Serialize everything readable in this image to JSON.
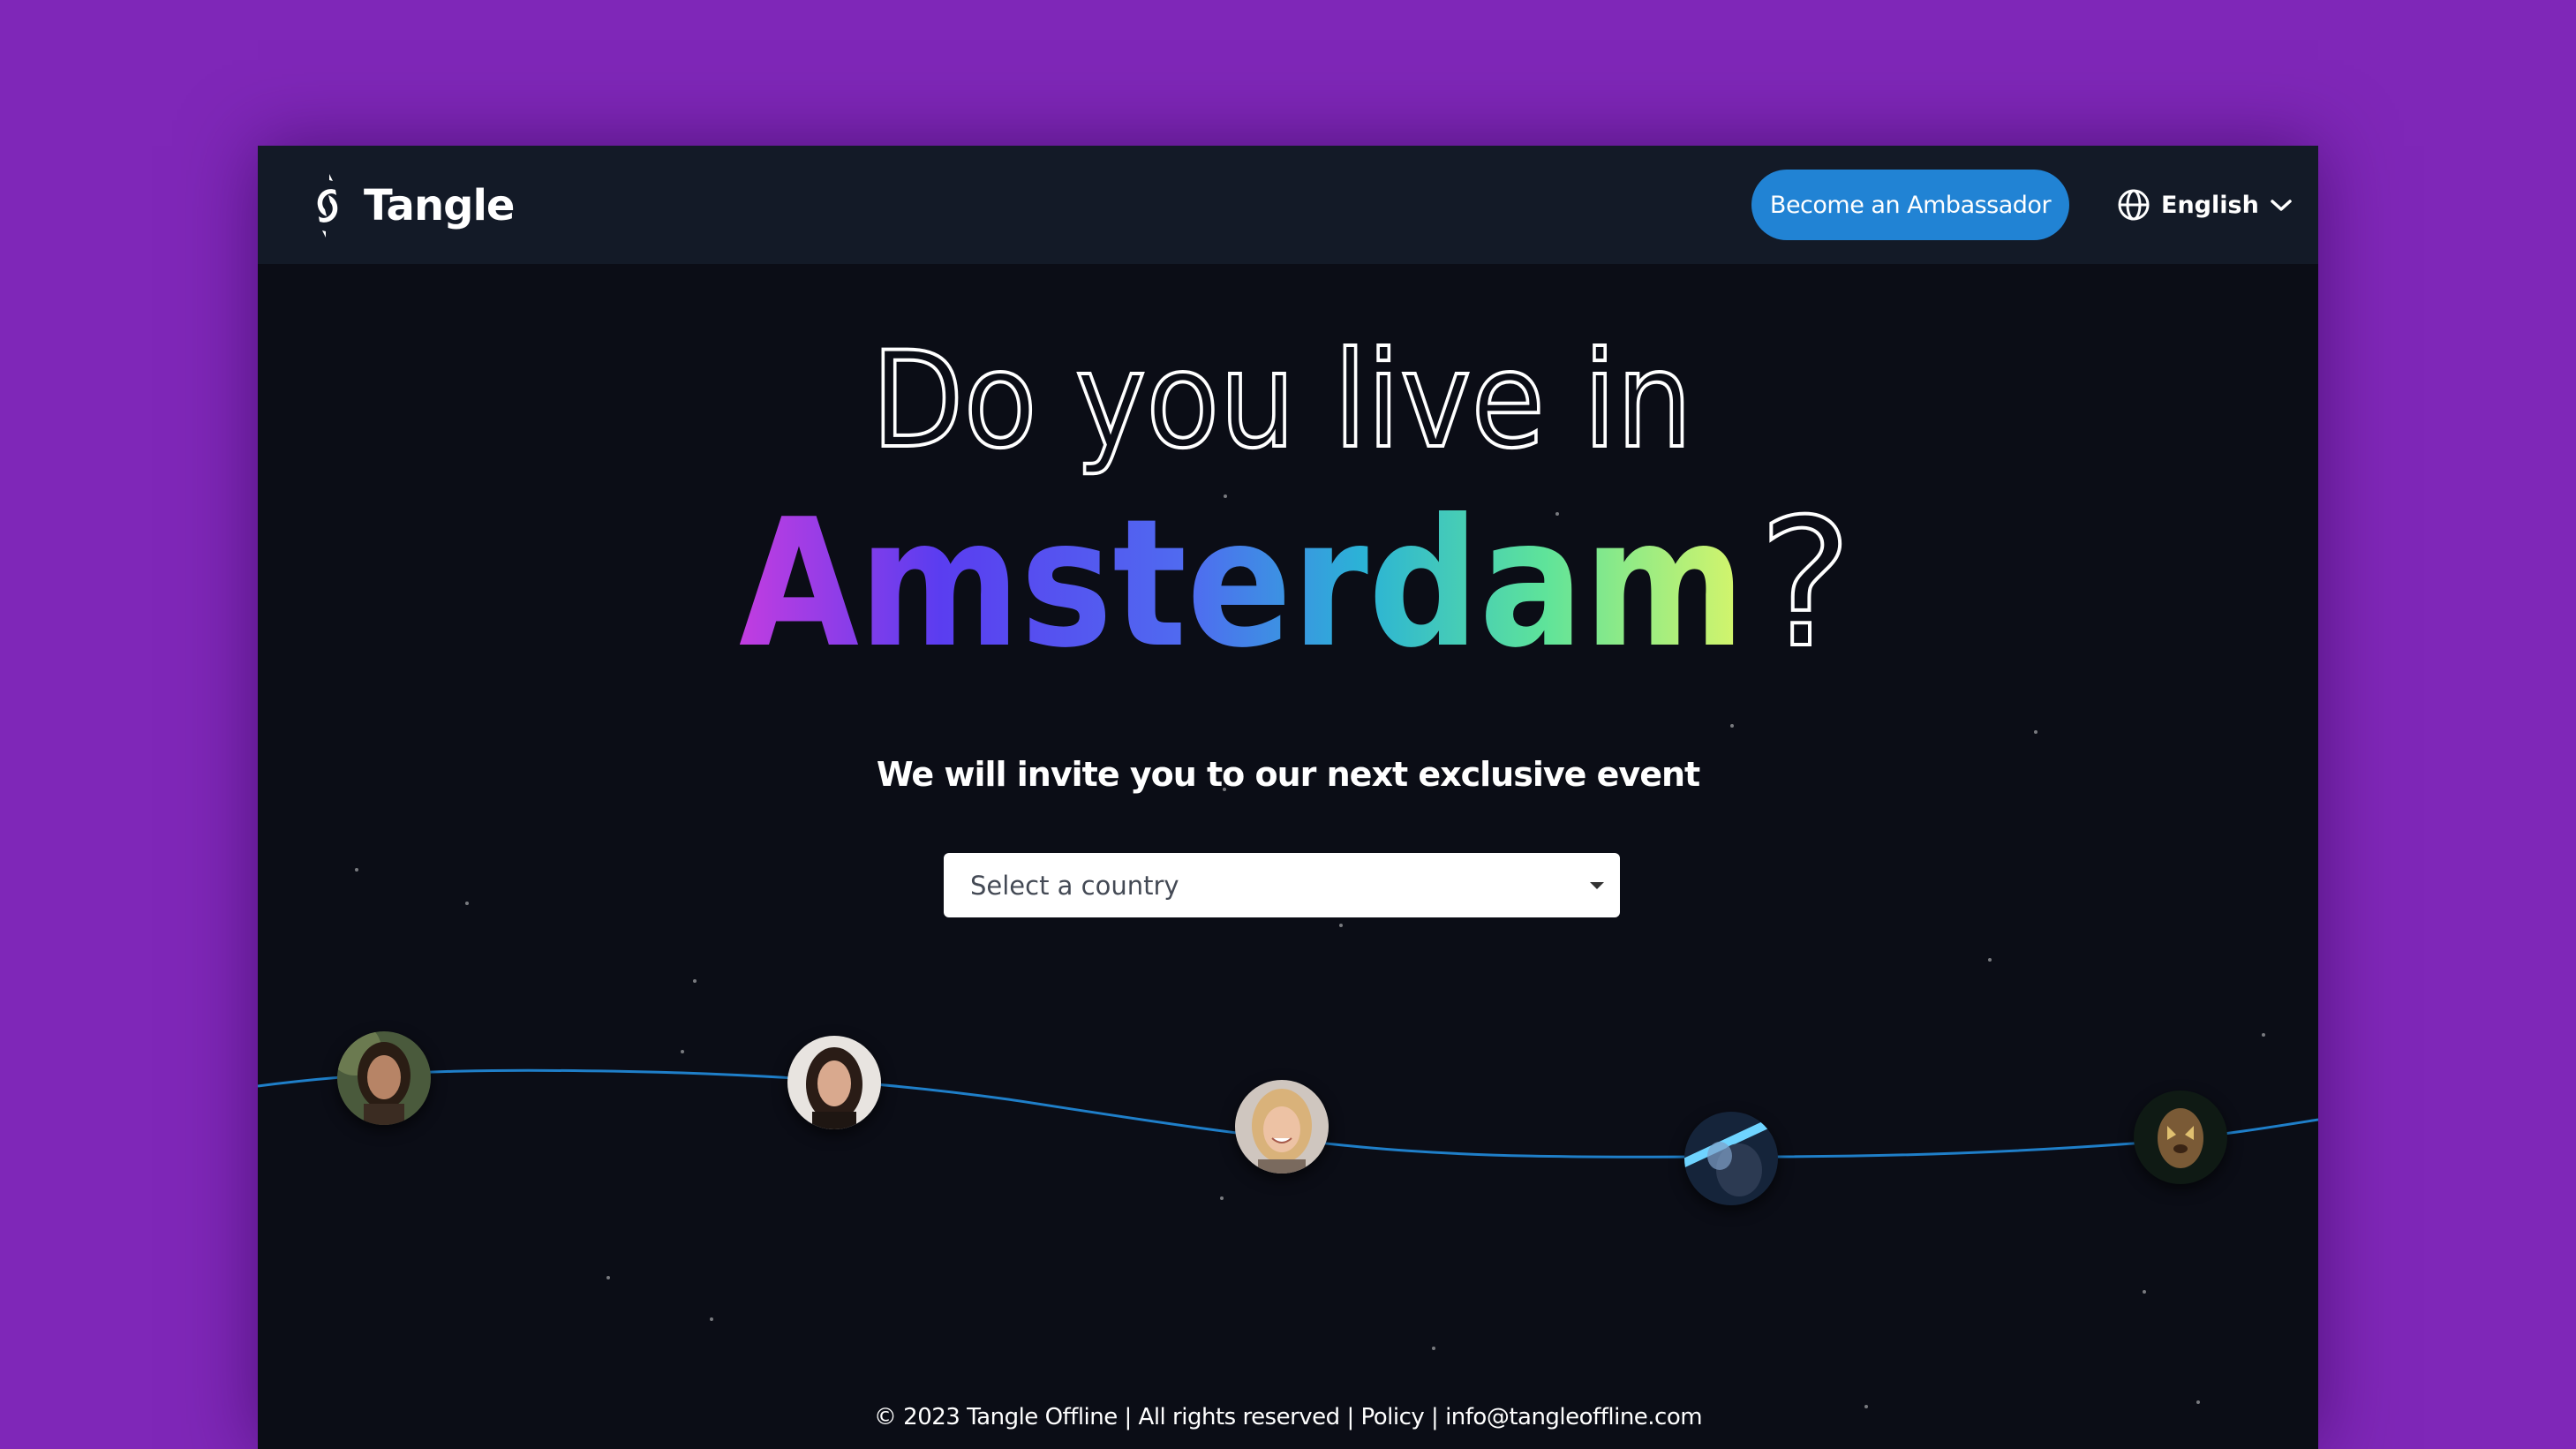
{
  "header": {
    "brand_name": "Tangle",
    "ambassador_button": "Become an Ambassador",
    "language": "English"
  },
  "hero": {
    "line1": "Do you live in",
    "city": "Amsterdam",
    "question_mark": "?",
    "subtitle": "We will invite you to our next exclusive event"
  },
  "country_select": {
    "placeholder": "Select a country"
  },
  "avatars": [
    {
      "label": "woman-dark-hair-outdoors"
    },
    {
      "label": "woman-dark-hair-smiling"
    },
    {
      "label": "woman-blonde-laughing"
    },
    {
      "label": "person-neon-light"
    },
    {
      "label": "person-face-paint"
    }
  ],
  "footer": {
    "copyright": "© 2023 Tangle Offline | All rights reserved | ",
    "policy": "Policy",
    "separator": " | ",
    "email": "info@tangleoffline.com"
  },
  "colors": {
    "page_background": "#7f27b8",
    "window_background": "#0b0d16",
    "header_background": "#131a27",
    "button_blue": "#2183d4",
    "wave_line": "#1f7fc9",
    "gradient": [
      "#c23de0",
      "#5a3df0",
      "#4f6cf0",
      "#2bb3d6",
      "#5ee39a",
      "#d8f56a"
    ]
  }
}
